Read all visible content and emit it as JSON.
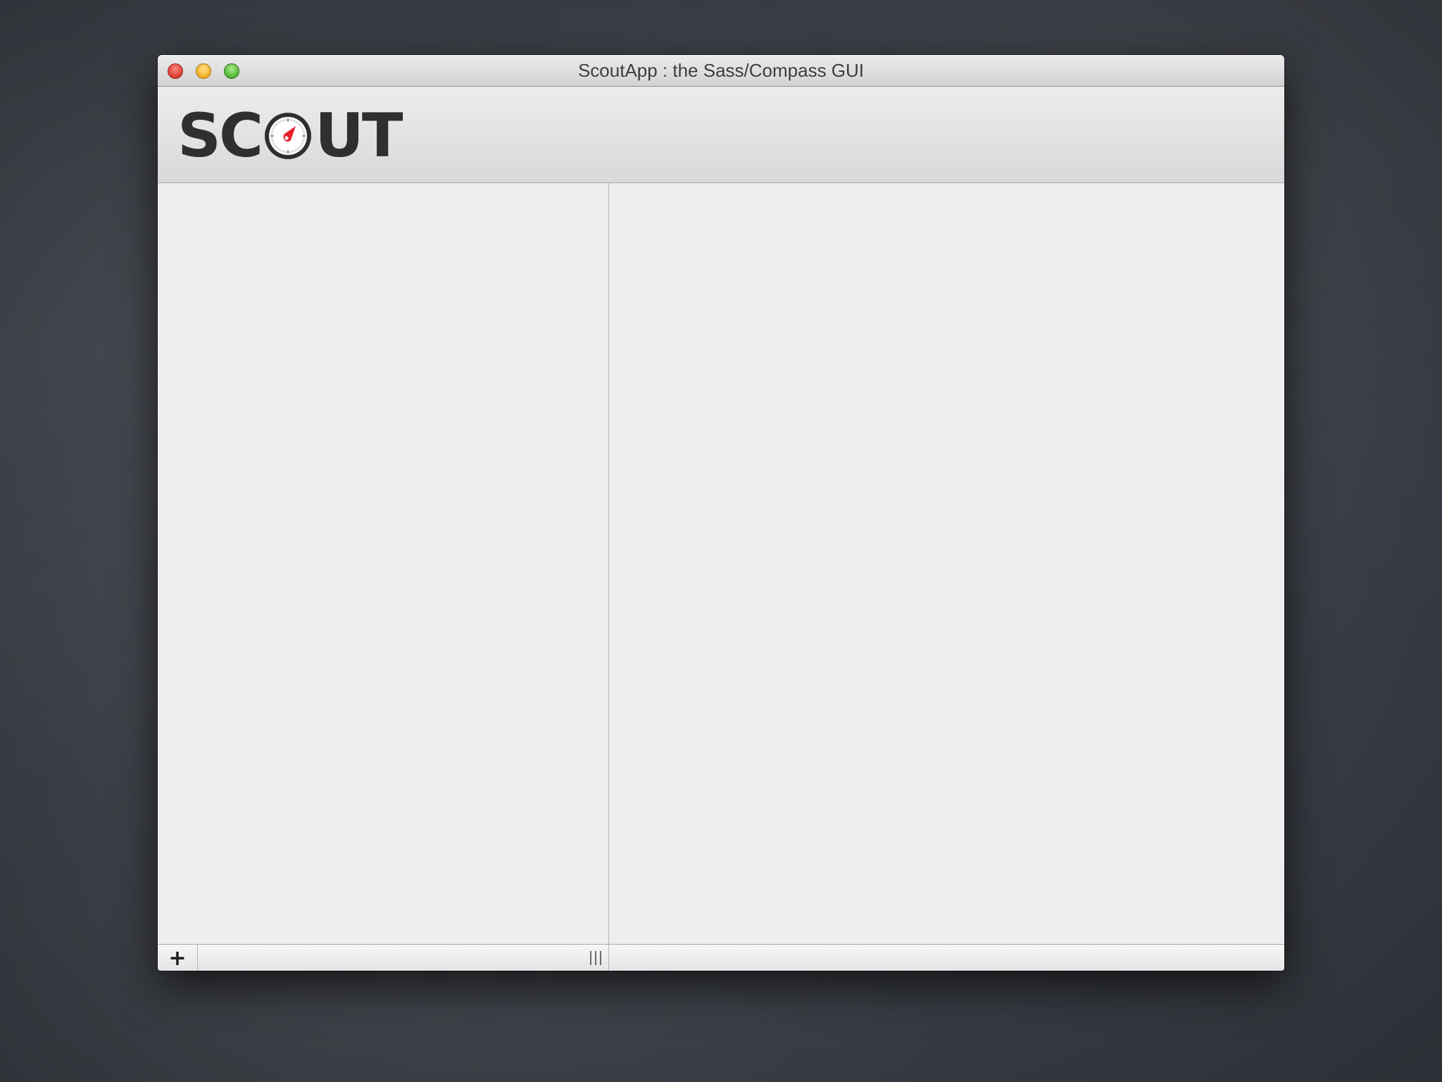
{
  "window": {
    "title": "ScoutApp : the Sass/Compass GUI"
  },
  "header": {
    "logo_text_left": "SC",
    "logo_text_right": "UT",
    "logo_icon": "compass-icon"
  },
  "bottom_bar": {
    "add_label": "+",
    "add_icon": "plus-icon",
    "resize_icon": "resize-handle-icon"
  },
  "colors": {
    "accent_red": "#e8212c",
    "logo_dark": "#2f2f31"
  }
}
